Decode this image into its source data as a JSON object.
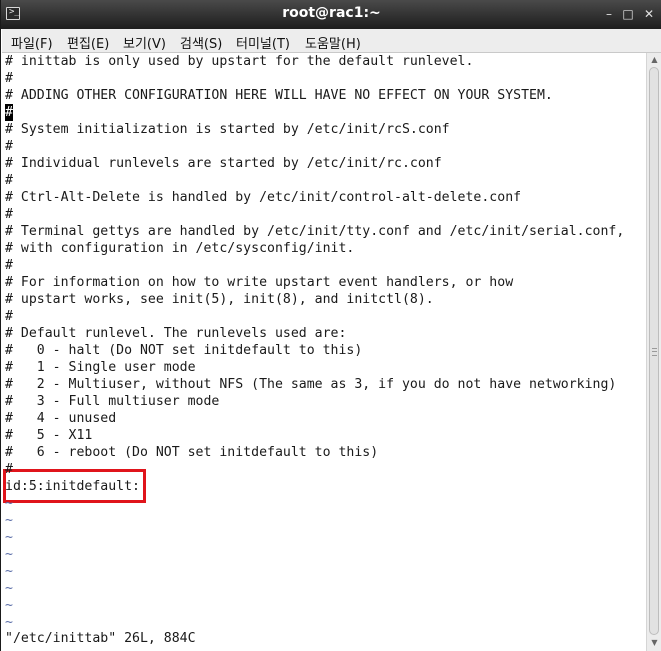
{
  "window": {
    "title": "root@rac1:~",
    "app_icon": "terminal-icon",
    "minimize_icon": "minimize-icon",
    "maximize_icon": "maximize-icon",
    "close_icon": "close-icon"
  },
  "menu": {
    "items": [
      {
        "label": "파일(F)"
      },
      {
        "label": "편집(E)"
      },
      {
        "label": "보기(V)"
      },
      {
        "label": "검색(S)"
      },
      {
        "label": "터미널(T)"
      },
      {
        "label": "도움말(H)"
      }
    ]
  },
  "editor": {
    "lines": [
      "# inittab is only used by upstart for the default runlevel.",
      "#",
      "# ADDING OTHER CONFIGURATION HERE WILL HAVE NO EFFECT ON YOUR SYSTEM.",
      "#",
      "# System initialization is started by /etc/init/rcS.conf",
      "#",
      "# Individual runlevels are started by /etc/init/rc.conf",
      "#",
      "# Ctrl-Alt-Delete is handled by /etc/init/control-alt-delete.conf",
      "#",
      "# Terminal gettys are handled by /etc/init/tty.conf and /etc/init/serial.conf,",
      "# with configuration in /etc/sysconfig/init.",
      "#",
      "# For information on how to write upstart event handlers, or how",
      "# upstart works, see init(5), init(8), and initctl(8).",
      "#",
      "# Default runlevel. The runlevels used are:",
      "#   0 - halt (Do NOT set initdefault to this)",
      "#   1 - Single user mode",
      "#   2 - Multiuser, without NFS (The same as 3, if you do not have networking)",
      "#   3 - Full multiuser mode",
      "#   4 - unused",
      "#   5 - X11",
      "#   6 - reboot (Do NOT set initdefault to this)",
      "#",
      "id:5:initdefault:",
      "~",
      "~",
      "~",
      "~",
      "~",
      "~",
      "~",
      "~"
    ],
    "cursor_line": 3,
    "highlighted_line": 25,
    "highlight_color": "#e0141b",
    "status_line": "\"/etc/inittab\" 26L, 884C"
  },
  "scrollbar": {
    "up_icon": "scroll-up-icon",
    "down_icon": "scroll-down-icon"
  }
}
